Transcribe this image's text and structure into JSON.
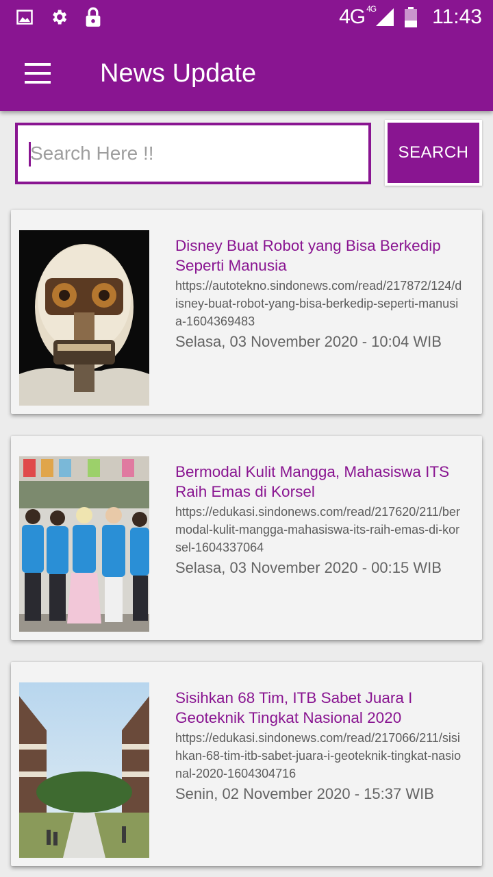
{
  "status_bar": {
    "left_icons": [
      "image-icon",
      "settings-gear-icon",
      "lock-icon"
    ],
    "network": "4G",
    "network_small": "4G",
    "time": "11:43"
  },
  "app_bar": {
    "title": "News Update",
    "menu_icon": "hamburger-menu-icon"
  },
  "search": {
    "placeholder": "Search Here !!",
    "value": "",
    "button_label": "SEARCH"
  },
  "colors": {
    "primary": "#891591",
    "card_bg": "#f3f3f3",
    "page_bg": "#ececec"
  },
  "news": [
    {
      "title": "Disney Buat Robot yang Bisa Berkedip Seperti Manusia",
      "url": "https://autotekno.sindonews.com/read/217872/124/disney-buat-robot-yang-bisa-berkedip-seperti-manusia-1604369483",
      "date": "Selasa, 03 November 2020 - 10:04 WIB",
      "thumbnail": "robot-face-photo"
    },
    {
      "title": "Bermodal Kulit Mangga, Mahasiswa ITS Raih Emas di Korsel",
      "url": "https://edukasi.sindonews.com/read/217620/211/bermodal-kulit-mangga-mahasiswa-its-raih-emas-di-korsel-1604337064",
      "date": "Selasa, 03 November 2020 - 00:15 WIB",
      "thumbnail": "students-group-photo"
    },
    {
      "title": "Sisihkan 68 Tim, ITB Sabet Juara I Geoteknik Tingkat Nasional 2020",
      "url": "https://edukasi.sindonews.com/read/217066/211/sisihkan-68-tim-itb-sabet-juara-i-geoteknik-tingkat-nasional-2020-1604304716",
      "date": "Senin, 02 November 2020 - 15:37 WIB",
      "thumbnail": "campus-building-photo"
    }
  ]
}
